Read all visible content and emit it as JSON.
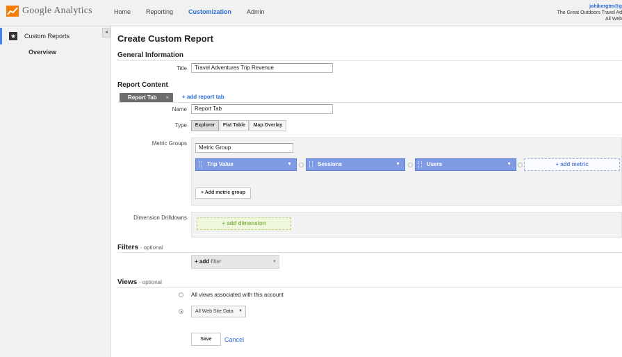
{
  "app": {
    "logo_text": "Google Analytics",
    "nav": [
      "Home",
      "Reporting",
      "Customization",
      "Admin"
    ],
    "active_nav": "Customization",
    "account": {
      "email": "johikergtm@g",
      "property": "The Great Outdoors Travel Ad",
      "view": "All Web"
    }
  },
  "sidebar": {
    "custom_reports": "Custom Reports",
    "overview": "Overview",
    "collapse_glyph": "◂"
  },
  "form": {
    "page_title": "Create Custom Report",
    "general_info": {
      "heading": "General Information",
      "title_label": "Title",
      "title_value": "Travel Adventures Trip Revenue"
    },
    "report_content": {
      "heading": "Report Content",
      "tab_chip": "Report Tab",
      "tab_close": "×",
      "add_report_tab": "+ add report tab",
      "name_label": "Name",
      "name_value": "Report Tab",
      "type_label": "Type",
      "type_options": [
        "Explorer",
        "Flat Table",
        "Map Overlay"
      ],
      "type_selected": "Explorer",
      "metric_groups_label": "Metric Groups",
      "metric_group_name": "Metric Group",
      "metrics": [
        "Trip Value",
        "Sessions",
        "Users"
      ],
      "add_metric": "+ add metric",
      "add_metric_group": "+ Add metric group",
      "dimension_label": "Dimension Drilldowns",
      "add_dimension": "+ add dimension"
    },
    "filters": {
      "heading": "Filters",
      "optional": "- optional",
      "add_filter_prefix": "+ add",
      "add_filter_word": "filter"
    },
    "views": {
      "heading": "Views",
      "optional": "- optional",
      "all_views_label": "All views associated with this account",
      "selected_view": "All Web Site Data"
    },
    "actions": {
      "save": "Save",
      "cancel": "Cancel"
    }
  }
}
